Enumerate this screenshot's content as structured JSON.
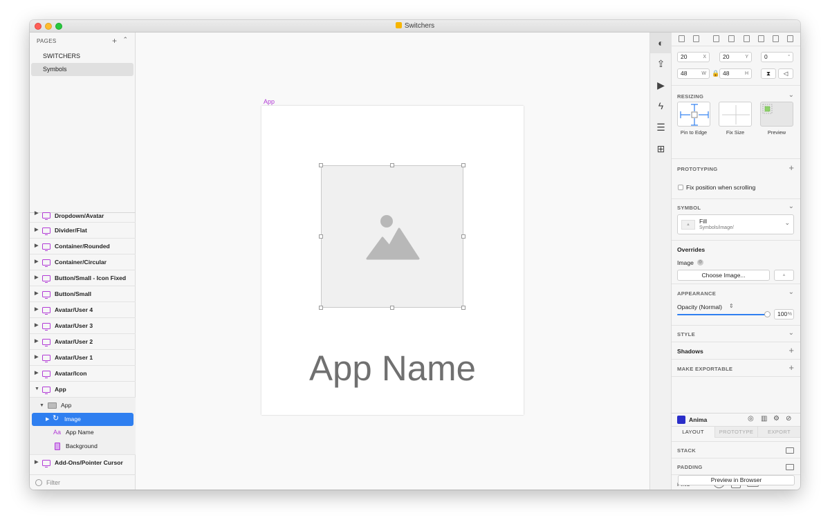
{
  "window": {
    "title": "Switchers"
  },
  "pages": {
    "header": "PAGES",
    "items": [
      {
        "label": "SWITCHERS",
        "selected": false
      },
      {
        "label": "Symbols",
        "selected": true
      }
    ]
  },
  "layers": {
    "rows": [
      "Dropdown/Avatar",
      "Divider/Flat",
      "Container/Rounded",
      "Container/Circular",
      "Button/Small - Icon Fixed",
      "Button/Small",
      "Avatar/User 4",
      "Avatar/User 3",
      "Avatar/User 2",
      "Avatar/User 1",
      "Avatar/Icon",
      "App"
    ],
    "app_children": {
      "group": "App",
      "image": "Image",
      "app_name": "App Name",
      "background": "Background",
      "text_icon": "Aa"
    },
    "last_row": "Add-Ons/Pointer Cursor",
    "filter_placeholder": "Filter"
  },
  "canvas": {
    "artboard_label": "App",
    "app_name_text": "App Name"
  },
  "inspector": {
    "x": "20",
    "x_unit": "X",
    "y": "20",
    "y_unit": "Y",
    "rotation": "0",
    "rotation_unit": "°",
    "w": "48",
    "w_unit": "W",
    "h": "48",
    "h_unit": "H",
    "resizing": {
      "title": "RESIZING",
      "options": [
        "Pin to Edge",
        "Fix Size",
        "Preview"
      ]
    },
    "prototyping": {
      "title": "PROTOTYPING",
      "fix_position": "Fix position when scrolling"
    },
    "symbol": {
      "title": "SYMBOL",
      "name": "Fill",
      "path": "Symbols/image/"
    },
    "overrides": {
      "title": "Overrides",
      "image_label": "Image",
      "choose_button": "Choose Image..."
    },
    "appearance": {
      "title": "APPEARANCE",
      "opacity_label": "Opacity (Normal)",
      "opacity_value": "100",
      "opacity_unit": "%"
    },
    "style": {
      "title": "STYLE",
      "shadows": "Shadows"
    },
    "exportable": {
      "title": "MAKE EXPORTABLE"
    },
    "anima": {
      "title": "Anima",
      "tabs": [
        "LAYOUT",
        "PROTOTYPE",
        "EXPORT"
      ],
      "stack": "STACK",
      "padding": "PADDING",
      "pins": "PINS",
      "preview_button": "Preview in Browser"
    }
  },
  "colors": {
    "selection": "#2f7ff0",
    "symbol_purple": "#b23bd6",
    "slider_blue": "#2f7ff0"
  }
}
